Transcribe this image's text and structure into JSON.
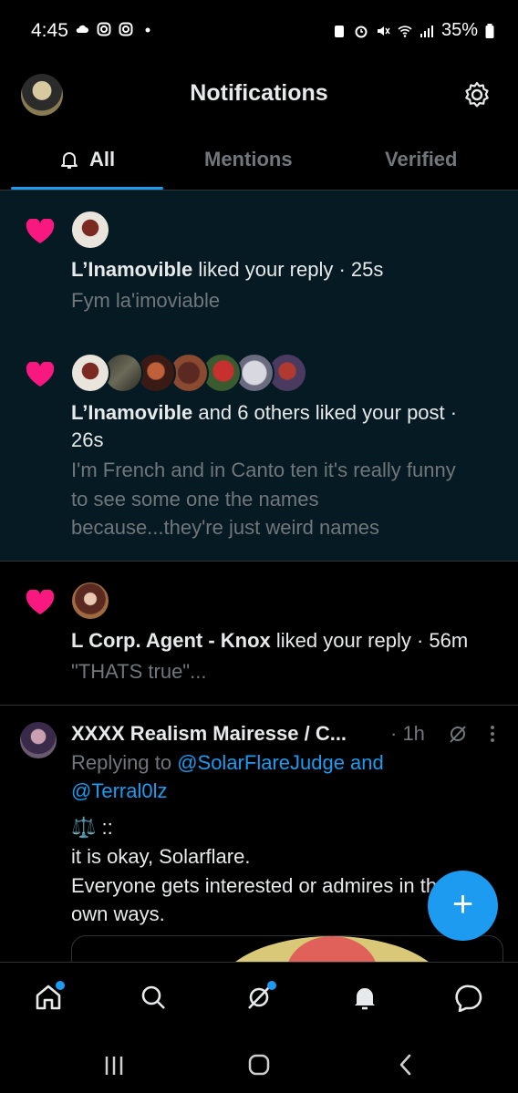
{
  "status_bar": {
    "time": "4:45",
    "battery": "35%",
    "icons": [
      "cloud-icon",
      "instagram-icon",
      "instagram-icon",
      "dot-icon",
      "battery-saver-icon",
      "alarm-icon",
      "mute-icon",
      "wifi-icon",
      "signal-icon",
      "battery-icon"
    ]
  },
  "header": {
    "title": "Notifications",
    "settings_icon": "gear-icon"
  },
  "tabs": [
    {
      "label": "All",
      "active": true,
      "icon": "bell-icon"
    },
    {
      "label": "Mentions",
      "active": false
    },
    {
      "label": "Verified",
      "active": false
    }
  ],
  "notifications": [
    {
      "type": "like",
      "user": "L’Inamovible",
      "action": " liked your reply · 25s",
      "snippet": "Fym la'imoviable"
    },
    {
      "type": "like",
      "user": "L’Inamovible",
      "action": " and 6 others liked your post ·",
      "time": "26s",
      "snippet_lines": [
        "I'm French and in Canto ten it's really funny",
        "to see some one the names",
        "because...they're just weird names"
      ]
    },
    {
      "type": "like",
      "user": "L Corp. Agent - Knox",
      "action": " liked your reply · 56m",
      "snippet": "\"THATS true\"..."
    }
  ],
  "reply": {
    "author": "XXXX Realism Mairesse / C...",
    "time": "· 1h",
    "replying_prefix": "Replying to ",
    "replying_to_1": "@SolarFlareJudge and",
    "replying_to_2": "@Terral0lz",
    "emoji_line": "⚖️ ::",
    "body_1": "it is okay, Solarflare.",
    "body_2": "Everyone gets interested or admires in their",
    "body_3": "own ways."
  },
  "fab": {
    "label": "+"
  },
  "bottom_tabs": [
    "home-icon",
    "search-icon",
    "grok-icon",
    "bell-icon",
    "messages-icon"
  ],
  "colors": {
    "accent": "#1d9bf0",
    "heart": "#f91880",
    "unread_bg": "#061a24"
  }
}
